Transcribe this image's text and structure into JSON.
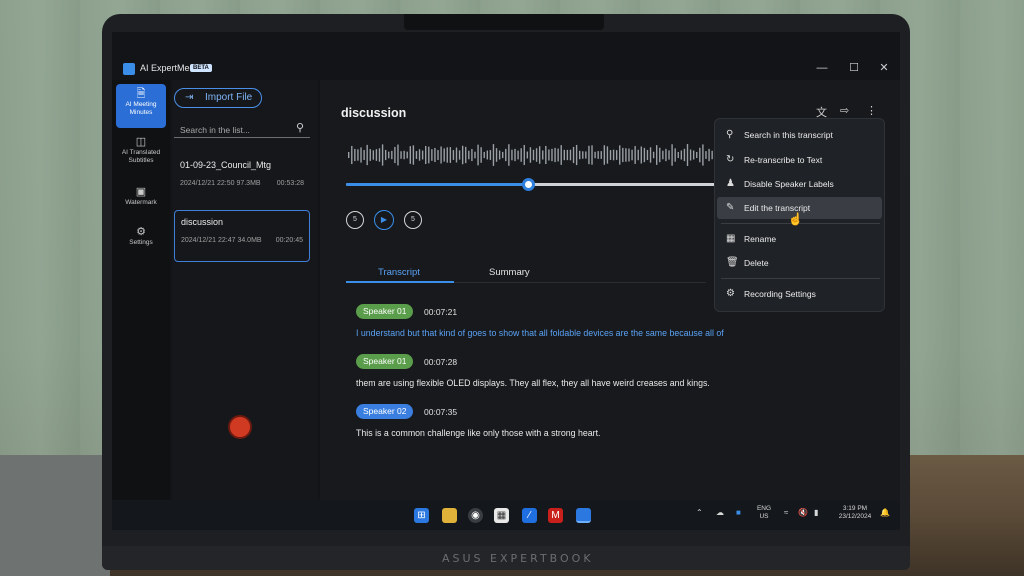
{
  "app": {
    "title": "AI ExpertMeet",
    "badge": "BETA",
    "window_controls": [
      "minimize-icon",
      "maximize-icon",
      "close-icon"
    ]
  },
  "sidebar": {
    "items": [
      {
        "label": "AI Meeting Minutes",
        "icon": "document-icon",
        "active": true
      },
      {
        "label": "AI Translated Subtitles",
        "icon": "subtitles-icon",
        "active": false
      },
      {
        "label": "Watermark",
        "icon": "watermark-icon",
        "active": false
      },
      {
        "label": "Settings",
        "icon": "gear-icon",
        "active": false
      }
    ]
  },
  "list": {
    "import_label": "Import File",
    "search_placeholder": "Search in the list...",
    "files": [
      {
        "name": "01-09-23_Council_Mtg",
        "meta": "2024/12/21 22:50 97.3MB",
        "duration": "00:53:28",
        "selected": false
      },
      {
        "name": "discussion",
        "meta": "2024/12/21 22:47 34.0MB",
        "duration": "00:20:45",
        "selected": true
      }
    ]
  },
  "main": {
    "title": "discussion",
    "playback": {
      "progress": 0.49
    },
    "tabs": [
      {
        "label": "Transcript",
        "active": true
      },
      {
        "label": "Summary",
        "active": false
      }
    ],
    "transcript": [
      {
        "speaker": "Speaker 01",
        "time": "00:07:21",
        "text": "I understand but that kind of goes to show that all foldable devices are the same because all of",
        "highlight": true
      },
      {
        "speaker": "Speaker 01",
        "time": "00:07:28",
        "text": "them are using flexible OLED displays. They all flex, they all have weird creases and kings.",
        "highlight": false
      },
      {
        "speaker": "Speaker 02",
        "time": "00:07:35",
        "text": "This is a common challenge like only those with a strong heart.",
        "highlight": false
      }
    ]
  },
  "menu": {
    "items": [
      {
        "label": "Search in this transcript",
        "icon": "search-icon"
      },
      {
        "label": "Re-transcribe to Text",
        "icon": "refresh-icon"
      },
      {
        "label": "Disable Speaker Labels",
        "icon": "people-icon"
      },
      {
        "label": "Edit the transcript",
        "icon": "pencil-icon",
        "hovered": true
      },
      {
        "label": "Rename",
        "icon": "rename-icon"
      },
      {
        "label": "Delete",
        "icon": "trash-icon"
      },
      {
        "label": "Recording Settings",
        "icon": "gear-icon"
      }
    ]
  },
  "taskbar": {
    "lang_line1": "ENG",
    "lang_line2": "US",
    "time": "3:19 PM",
    "date": "23/12/2024"
  },
  "device": {
    "brand": "ASUS EXPERTBOOK"
  },
  "colors": {
    "accent": "#3a8ee8",
    "speaker1": "#5a9d4a",
    "speaker2": "#3a7fe0",
    "record": "#d13a22"
  }
}
